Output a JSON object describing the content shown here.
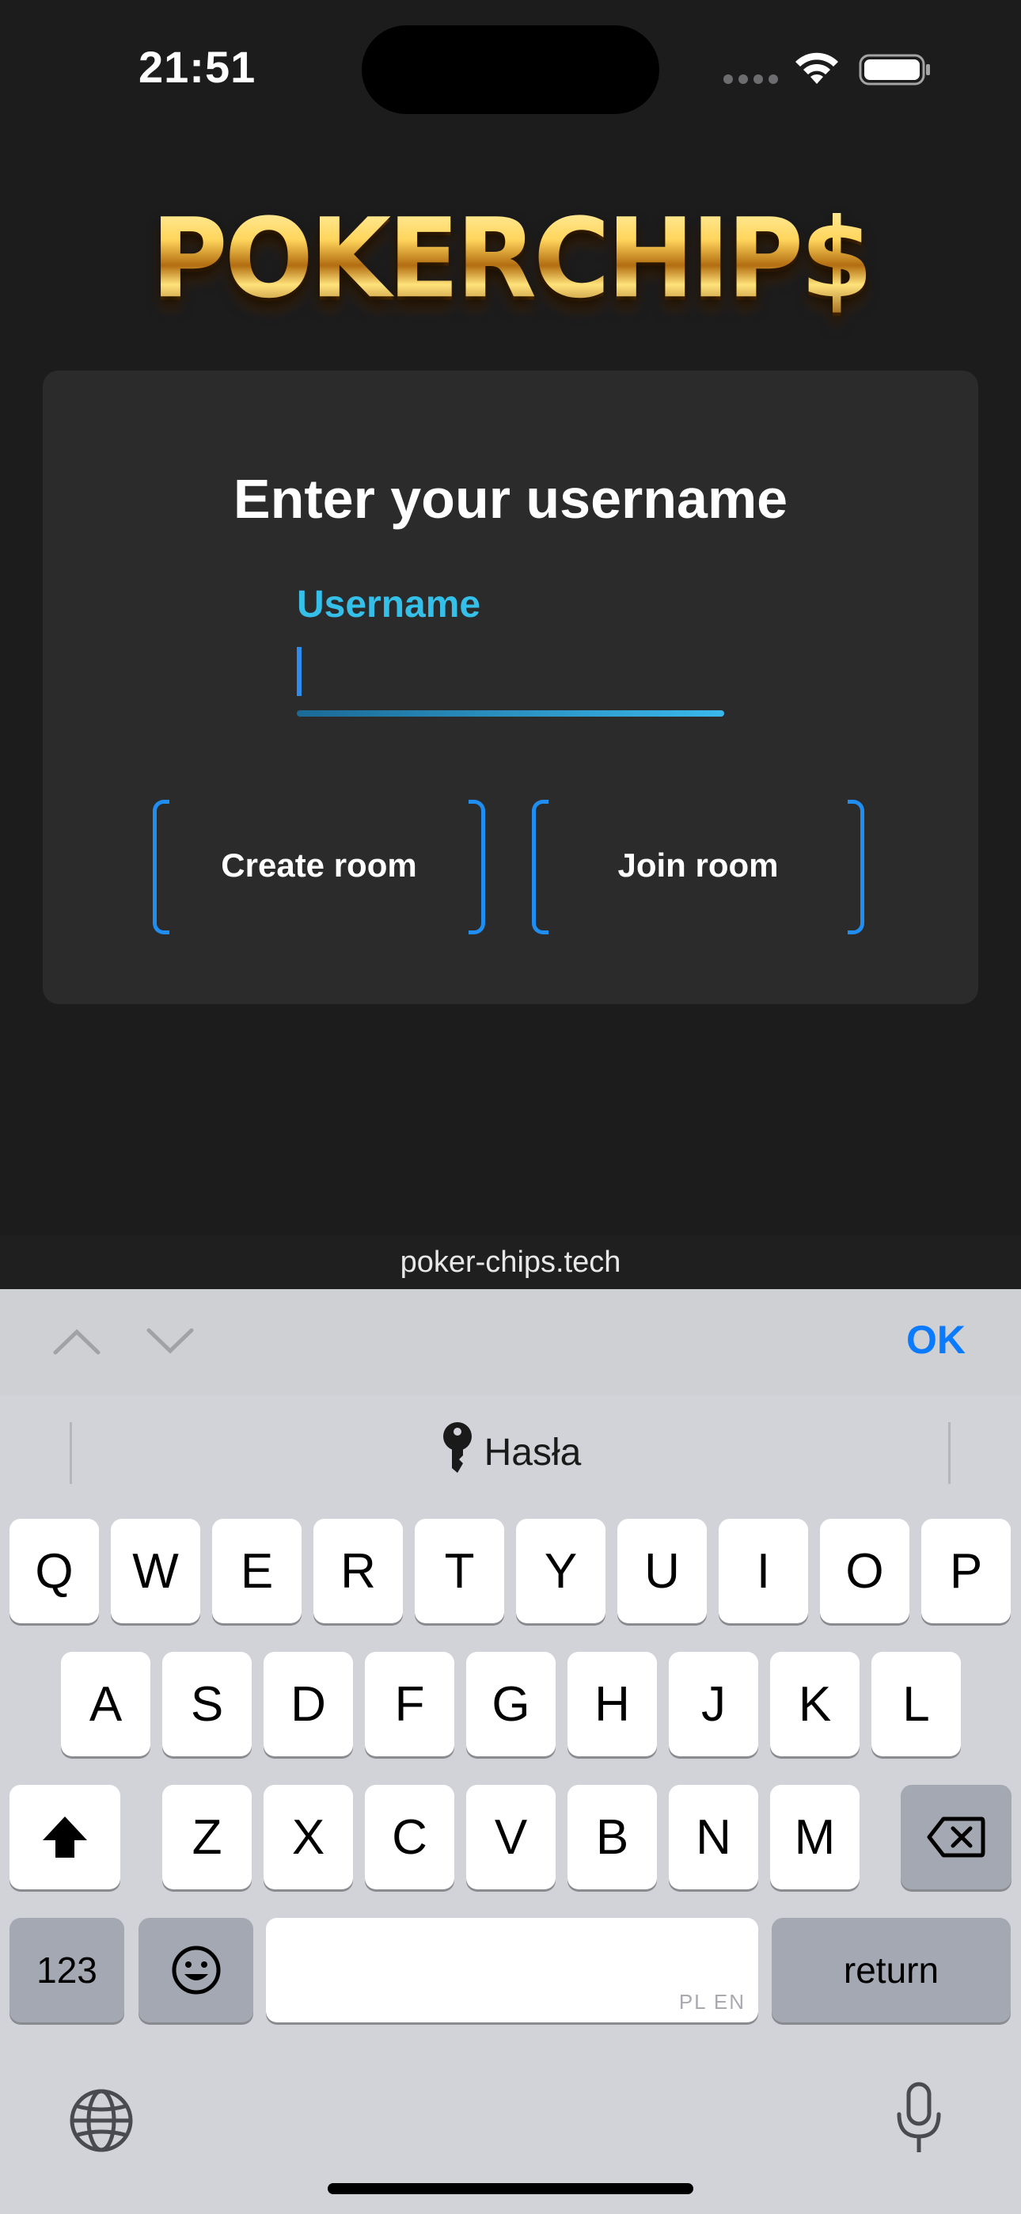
{
  "status_bar": {
    "time": "21:51"
  },
  "logo": {
    "text": "POKERCHIP$"
  },
  "card": {
    "title": "Enter your username",
    "username_label": "Username",
    "username_value": "",
    "create_room_label": "Create room",
    "join_room_label": "Join room"
  },
  "browser": {
    "url": "poker-chips.tech"
  },
  "accessory": {
    "ok_label": "OK"
  },
  "keyboard": {
    "passwords_label": "Hasła",
    "row1": [
      "Q",
      "W",
      "E",
      "R",
      "T",
      "Y",
      "U",
      "I",
      "O",
      "P"
    ],
    "row2": [
      "A",
      "S",
      "D",
      "F",
      "G",
      "H",
      "J",
      "K",
      "L"
    ],
    "row3": [
      "Z",
      "X",
      "C",
      "V",
      "B",
      "N",
      "M"
    ],
    "numbers_label": "123",
    "space_languages": "PL EN",
    "return_label": "return"
  },
  "colors": {
    "accent_cyan": "#35c0ea",
    "button_bracket": "#1f8ef0",
    "ok_blue": "#0a7aff",
    "background": "#1c1c1d",
    "card": "#2b2b2c"
  },
  "icons": [
    "wifi-icon",
    "battery-icon",
    "chevron-up-icon",
    "chevron-down-icon",
    "key-icon",
    "shift-icon",
    "delete-icon",
    "emoji-icon",
    "globe-icon",
    "microphone-icon"
  ]
}
